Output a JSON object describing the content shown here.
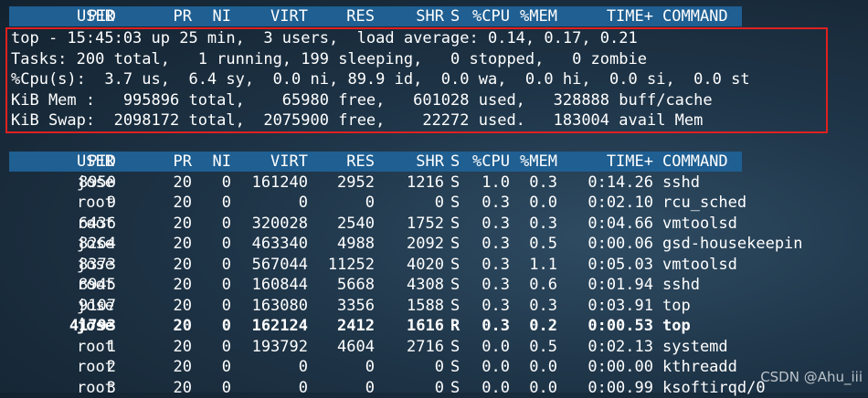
{
  "columns": [
    "PID",
    "USER",
    "PR",
    "NI",
    "VIRT",
    "RES",
    "SHR",
    "S",
    "%CPU",
    "%MEM",
    "TIME+",
    "COMMAND"
  ],
  "summary": {
    "line1": "top - 15:45:03 up 25 min,  3 users,  load average: 0.14, 0.17, 0.21",
    "line2": "Tasks: 200 total,   1 running, 199 sleeping,   0 stopped,   0 zombie",
    "line3": "%Cpu(s):  3.7 us,  6.4 sy,  0.0 ni, 89.9 id,  0.0 wa,  0.0 hi,  0.0 si,  0.0 st",
    "line4": "KiB Mem :   995896 total,    65980 free,   601028 used,   328888 buff/cache",
    "line5": "KiB Swap:  2098172 total,  2075900 free,    22272 used.   183004 avail Mem"
  },
  "processes": [
    {
      "pid": "8950",
      "user": "jose",
      "pr": "20",
      "ni": "0",
      "virt": "161240",
      "res": "2952",
      "shr": "1216",
      "s": "S",
      "cpu": "1.0",
      "mem": "0.3",
      "time": "0:14.26",
      "command": "sshd",
      "bold": false
    },
    {
      "pid": "9",
      "user": "root",
      "pr": "20",
      "ni": "0",
      "virt": "0",
      "res": "0",
      "shr": "0",
      "s": "S",
      "cpu": "0.3",
      "mem": "0.0",
      "time": "0:02.10",
      "command": "rcu_sched",
      "bold": false
    },
    {
      "pid": "6436",
      "user": "root",
      "pr": "20",
      "ni": "0",
      "virt": "320028",
      "res": "2540",
      "shr": "1752",
      "s": "S",
      "cpu": "0.3",
      "mem": "0.3",
      "time": "0:04.66",
      "command": "vmtoolsd",
      "bold": false
    },
    {
      "pid": "8264",
      "user": "jose",
      "pr": "20",
      "ni": "0",
      "virt": "463340",
      "res": "4988",
      "shr": "2092",
      "s": "S",
      "cpu": "0.3",
      "mem": "0.5",
      "time": "0:00.06",
      "command": "gsd-housekeepin",
      "bold": false
    },
    {
      "pid": "8373",
      "user": "jose",
      "pr": "20",
      "ni": "0",
      "virt": "567044",
      "res": "11252",
      "shr": "4020",
      "s": "S",
      "cpu": "0.3",
      "mem": "1.1",
      "time": "0:05.03",
      "command": "vmtoolsd",
      "bold": false
    },
    {
      "pid": "8945",
      "user": "root",
      "pr": "20",
      "ni": "0",
      "virt": "160844",
      "res": "5668",
      "shr": "4308",
      "s": "S",
      "cpu": "0.3",
      "mem": "0.6",
      "time": "0:01.94",
      "command": "sshd",
      "bold": false
    },
    {
      "pid": "9107",
      "user": "jose",
      "pr": "20",
      "ni": "0",
      "virt": "163080",
      "res": "3356",
      "shr": "1588",
      "s": "S",
      "cpu": "0.3",
      "mem": "0.3",
      "time": "0:03.91",
      "command": "top",
      "bold": false
    },
    {
      "pid": "41793",
      "user": "jose",
      "pr": "20",
      "ni": "0",
      "virt": "162124",
      "res": "2412",
      "shr": "1616",
      "s": "R",
      "cpu": "0.3",
      "mem": "0.2",
      "time": "0:00.53",
      "command": "top",
      "bold": true
    },
    {
      "pid": "1",
      "user": "root",
      "pr": "20",
      "ni": "0",
      "virt": "193792",
      "res": "4604",
      "shr": "2716",
      "s": "S",
      "cpu": "0.0",
      "mem": "0.5",
      "time": "0:02.13",
      "command": "systemd",
      "bold": false
    },
    {
      "pid": "2",
      "user": "root",
      "pr": "20",
      "ni": "0",
      "virt": "0",
      "res": "0",
      "shr": "0",
      "s": "S",
      "cpu": "0.0",
      "mem": "0.0",
      "time": "0:00.00",
      "command": "kthreadd",
      "bold": false
    },
    {
      "pid": "3",
      "user": "root",
      "pr": "20",
      "ni": "0",
      "virt": "0",
      "res": "0",
      "shr": "0",
      "s": "S",
      "cpu": "0.0",
      "mem": "0.0",
      "time": "0:00.99",
      "command": "ksoftirqd/0",
      "bold": false
    }
  ],
  "watermark": "CSDN @Ahu_iii"
}
